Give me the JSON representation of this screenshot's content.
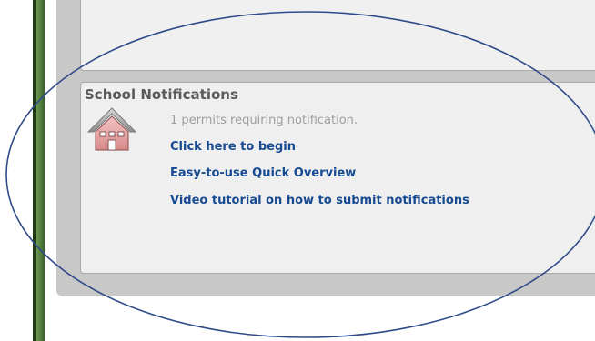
{
  "colors": {
    "link": "#174a91",
    "title": "#5a5a5a",
    "muted_text": "#9e9e9e",
    "panel_bg": "#c8c8c8",
    "box_bg": "#efefef",
    "annotation_ellipse": "#2f4c8a",
    "house_roof": "#9a9a9a",
    "house_body": "#e6a2a2"
  },
  "icons": {
    "school": "school-house-icon"
  },
  "school_notifications": {
    "title": "School Notifications",
    "permits_text": "1 permits requiring notification.",
    "links": [
      {
        "label": "Click here to begin"
      },
      {
        "label": "Easy-to-use Quick Overview"
      },
      {
        "label": "Video tutorial on how to submit notifications"
      }
    ]
  }
}
